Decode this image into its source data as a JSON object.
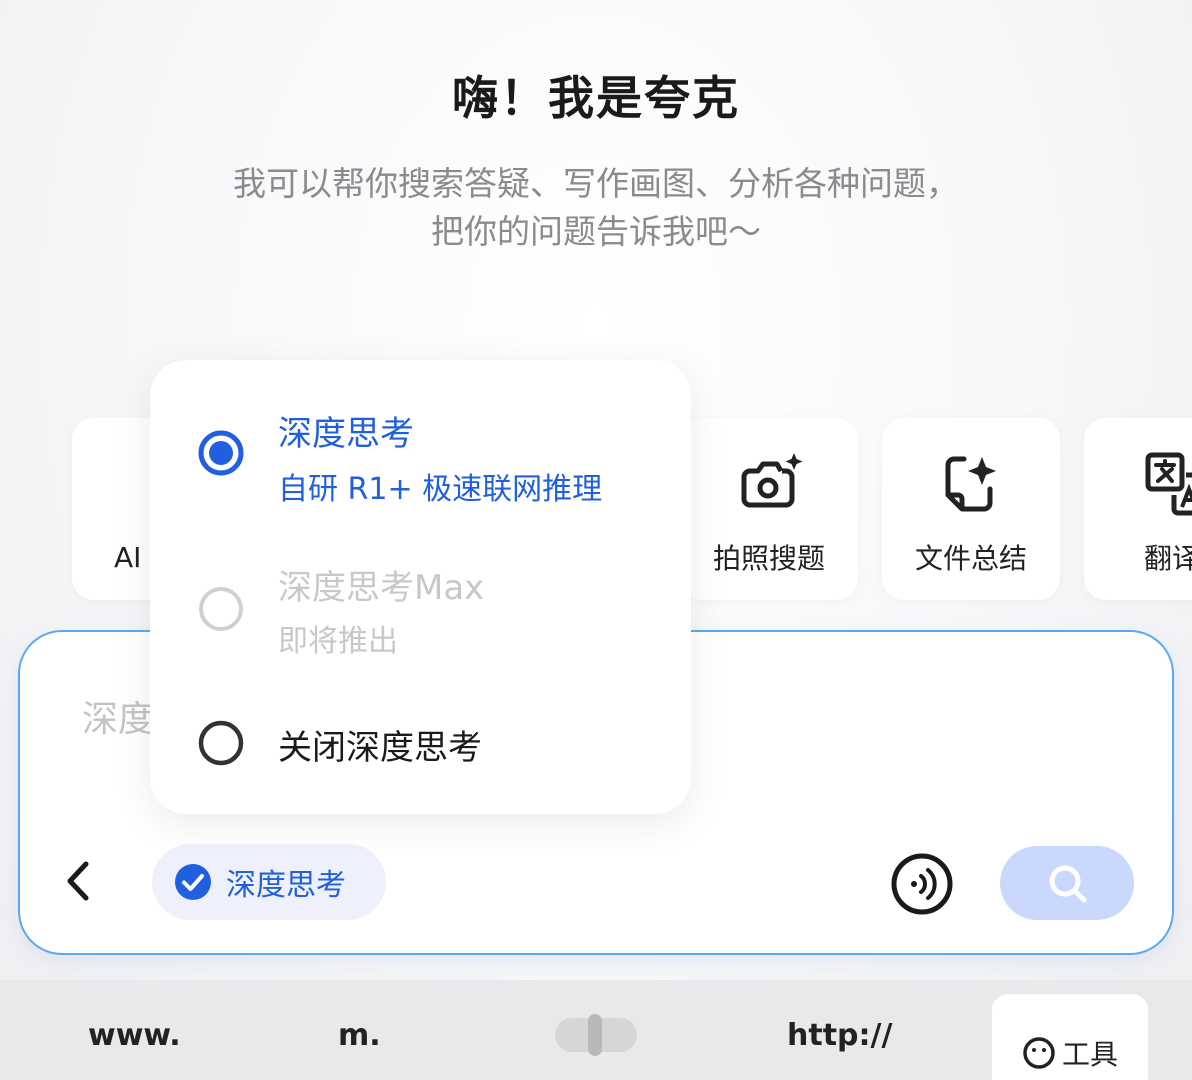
{
  "header": {
    "title": "嗨！我是夸克",
    "subtitle_line1": "我可以帮你搜索答疑、写作画图、分析各种问题，",
    "subtitle_line2": "把你的问题告诉我吧～"
  },
  "tools": [
    {
      "label": "AI",
      "icon": "sparkle-icon"
    },
    {
      "label": "拍照搜题",
      "icon": "camera-sparkle-icon"
    },
    {
      "label": "文件总结",
      "icon": "file-sparkle-icon"
    },
    {
      "label": "翻译",
      "icon": "translate-icon"
    }
  ],
  "dropdown": {
    "options": [
      {
        "title": "深度思考",
        "subtitle": "自研 R1+ 极速联网推理",
        "state": "selected"
      },
      {
        "title": "深度思考Max",
        "subtitle": "即将推出",
        "state": "disabled"
      },
      {
        "title": "关闭深度思考",
        "subtitle": "",
        "state": "unselected"
      }
    ]
  },
  "input": {
    "placeholder_visible": "深度",
    "chip_label": "深度思考"
  },
  "bottom_bar": {
    "www": "www.",
    "m": "m.",
    "http": "http://",
    "tool_label": "工具"
  },
  "colors": {
    "accent": "#1f5fe0",
    "input_border": "#5aa9f0",
    "search_button": "#c9d8fc",
    "disabled": "#c8c8cc"
  }
}
